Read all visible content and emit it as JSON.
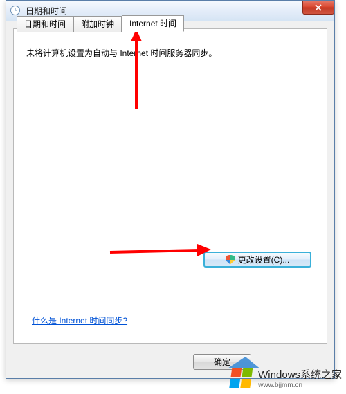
{
  "window": {
    "title": "日期和时间"
  },
  "tabs": {
    "items": [
      {
        "label": "日期和时间"
      },
      {
        "label": "附加时钟"
      },
      {
        "label": "Internet 时间"
      }
    ],
    "active_index": 2
  },
  "body": {
    "message": "未将计算机设置为自动与 Internet 时间服务器同步。"
  },
  "buttons": {
    "change_settings": "更改设置(C)...",
    "ok": "确定"
  },
  "link": {
    "help": "什么是 Internet 时间同步?"
  },
  "watermark": {
    "main": "Windows系统之家",
    "sub": "www.bjjmm.cn"
  }
}
